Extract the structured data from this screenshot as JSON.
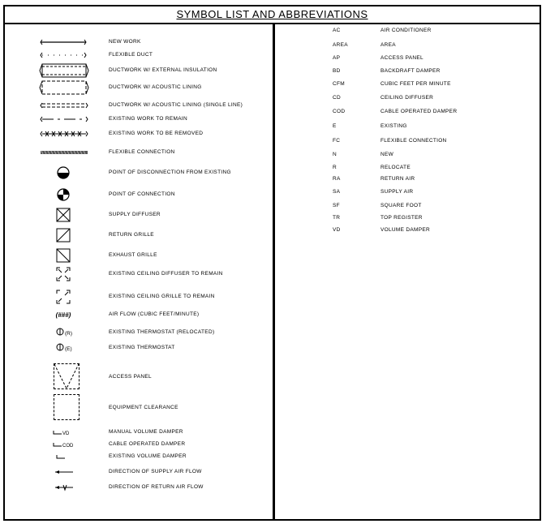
{
  "title": "SYMBOL LIST AND ABBREVIATIONS",
  "symbols": [
    {
      "label": "NEW WORK",
      "icon": "new-work-line"
    },
    {
      "label": "FLEXIBLE DUCT",
      "icon": "flexible-duct-line"
    },
    {
      "label": "DUCTWORK W/ EXTERNAL INSULATION",
      "icon": "duct-external-insulation"
    },
    {
      "label": "DUCTWORK W/ ACOUSTIC LINING",
      "icon": "duct-acoustic-lining"
    },
    {
      "label": "DUCTWORK W/ ACOUSTIC LINING (SINGLE LINE)",
      "icon": "duct-acoustic-single-line"
    },
    {
      "label": "EXISTING WORK TO REMAIN",
      "icon": "existing-work-line"
    },
    {
      "label": "EXISTING WORK TO BE REMOVED",
      "icon": "removed-work-line"
    },
    {
      "label": "FLEXIBLE CONNECTION",
      "icon": "flexible-connection"
    },
    {
      "label": "POINT OF DISCONNECTION FROM EXISTING",
      "icon": "disconnection-circle"
    },
    {
      "label": "POINT OF CONNECTION",
      "icon": "connection-circle"
    },
    {
      "label": "SUPPLY DIFFUSER",
      "icon": "supply-diffuser-square"
    },
    {
      "label": "RETURN GRILLE",
      "icon": "return-grille-square"
    },
    {
      "label": "EXHAUST GRILLE",
      "icon": "exhaust-grille-square"
    },
    {
      "label": "EXISTING CEILING DIFFUSER TO REMAIN",
      "icon": "existing-diffuser"
    },
    {
      "label": "EXISTING CEILING GRILLE TO REMAIN",
      "icon": "existing-grille"
    },
    {
      "label": "AIR FLOW (CUBIC FEET/MINUTE)",
      "icon": "air-flow-tag",
      "tag": "(###)"
    },
    {
      "label": "EXISTING THERMOSTAT (RELOCATED)",
      "icon": "thermostat-relocated",
      "tag": "(R)"
    },
    {
      "label": "EXISTING THERMOSTAT",
      "icon": "thermostat-existing",
      "tag": "(E)"
    },
    {
      "label": "ACCESS PANEL",
      "icon": "access-panel"
    },
    {
      "label": "EQUIPMENT CLEARANCE",
      "icon": "equipment-clearance"
    },
    {
      "label": "MANUAL VOLUME DAMPER",
      "icon": "manual-volume-damper",
      "tag": "VD"
    },
    {
      "label": "CABLE OPERATED DAMPER",
      "icon": "cable-operated-damper",
      "tag": "COD"
    },
    {
      "label": "EXISTING VOLUME DAMPER",
      "icon": "existing-volume-damper"
    },
    {
      "label": "DIRECTION OF SUPPLY AIR FLOW",
      "icon": "supply-flow-arrow"
    },
    {
      "label": "DIRECTION OF RETURN AIR FLOW",
      "icon": "return-flow-arrow"
    }
  ],
  "abbreviations": [
    {
      "code": "AC",
      "desc": "AIR CONDITIONER"
    },
    {
      "code": "AREA",
      "desc": "AREA"
    },
    {
      "code": "AP",
      "desc": "ACCESS PANEL"
    },
    {
      "code": "BD",
      "desc": "BACKDRAFT DAMPER"
    },
    {
      "code": "CFM",
      "desc": "CUBIC FEET PER MINUTE"
    },
    {
      "code": "CD",
      "desc": "CEILING DIFFUSER"
    },
    {
      "code": "COD",
      "desc": "CABLE OPERATED DAMPER"
    },
    {
      "code": "E",
      "desc": "EXISTING"
    },
    {
      "code": "FC",
      "desc": "FLEXIBLE CONNECTION"
    },
    {
      "code": "N",
      "desc": "NEW"
    },
    {
      "code": "R",
      "desc": "RELOCATE"
    },
    {
      "code": "RA",
      "desc": "RETURN AIR"
    },
    {
      "code": "SA",
      "desc": "SUPPLY AIR"
    },
    {
      "code": "SF",
      "desc": "SQUARE FOOT"
    },
    {
      "code": "TR",
      "desc": "TOP REGISTER"
    },
    {
      "code": "VD",
      "desc": "VOLUME DAMPER"
    }
  ]
}
